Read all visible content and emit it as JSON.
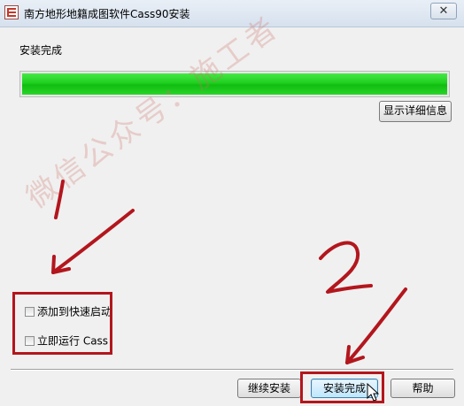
{
  "window": {
    "title": "南方地形地籍成图软件Cass90安装",
    "close_glyph": "✕"
  },
  "main": {
    "status_label": "安装完成",
    "progress_fraction": 1.0,
    "details_button": "显示详细信息"
  },
  "options": {
    "quick_launch": {
      "label": "添加到快速启动",
      "checked": false
    },
    "run_now": {
      "label": "立即运行 Cass",
      "checked": false
    }
  },
  "footer": {
    "continue_button": "继续安装",
    "finish_button": "安装完成",
    "help_button": "帮助"
  },
  "watermark": "微信公众号：施工者",
  "annotations": {
    "number_one": "1",
    "number_two": "2",
    "color": "#b3161d"
  }
}
